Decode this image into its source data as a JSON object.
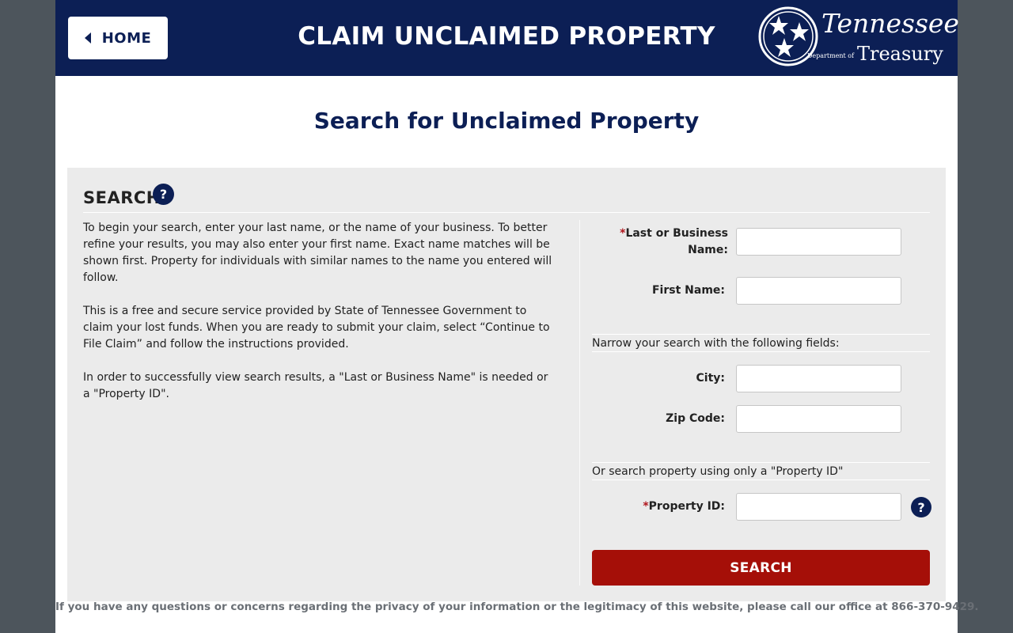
{
  "header": {
    "home_label": "HOME",
    "title": "CLAIM UNCLAIMED PROPERTY",
    "logo": {
      "word": "Tennessee",
      "dept": "Department of",
      "treasury": "Treasury"
    }
  },
  "page_heading": "Search for Unclaimed Property",
  "search_panel": {
    "title": "SEARCH",
    "help_glyph": "?",
    "paragraphs": [
      "To begin your search, enter your last name, or the name of your business. To better refine your results, you may also enter your first name. Exact name matches will be shown first. Property for individuals with similar names to the name you entered will follow.",
      "This is a free and secure service provided by State of Tennessee Government to claim your lost funds. When you are ready to submit your claim, select “Continue to File Claim” and follow the instructions provided.",
      "In order to successfully view search results, a \"Last or Business Name\" is needed or a \"Property ID\"."
    ],
    "fields": {
      "last_name": {
        "required_mark": "*",
        "label": "Last or Business Name:",
        "value": ""
      },
      "first_name": {
        "label": "First Name:",
        "value": ""
      },
      "narrow_note": "Narrow your search with the following fields:",
      "city": {
        "label": "City:",
        "value": ""
      },
      "zip": {
        "label": "Zip Code:",
        "value": ""
      },
      "property_note": "Or search property using only a \"Property ID\"",
      "property_id": {
        "required_mark": "*",
        "label": "Property ID:",
        "value": ""
      }
    },
    "search_button": "SEARCH"
  },
  "footer_note": "If you have any questions or concerns regarding the privacy of your information or the legitimacy of this website, please call our office at 866-370-9429.",
  "colors": {
    "navy": "#0c1f55",
    "search_button": "#a50f08",
    "required": "#b0151c",
    "panel_bg": "#ebebeb"
  }
}
